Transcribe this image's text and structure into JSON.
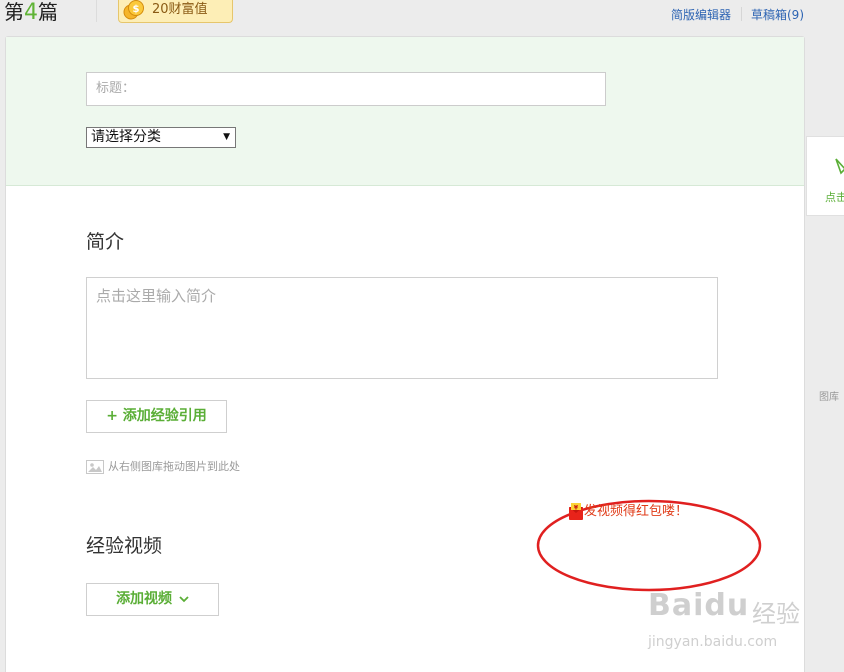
{
  "header": {
    "article_prefix": "第",
    "article_number": "4",
    "article_suffix": "篇",
    "wealth_label": "20财富值",
    "links": {
      "simple_editor": "简版编辑器",
      "drafts": "草稿箱(9)"
    }
  },
  "form": {
    "title_placeholder": "标题：",
    "category_select": "请选择分类",
    "intro_heading": "简介",
    "intro_placeholder": "点击这里输入简介",
    "add_reference_button": "+ 添加经验引用",
    "drag_hint": "从右侧图库拖动图片到此处",
    "video_heading": "经验视频",
    "add_video_button": "添加视频",
    "video_promo": "发视频得红包喽！"
  },
  "side_panel": {
    "label": "点击",
    "hint": "图库"
  },
  "watermark": {
    "brand": "Baidu",
    "brand_cn": "经验",
    "url": "jingyan.baidu.com"
  },
  "colors": {
    "accent_green": "#5aae36",
    "link_blue": "#2d64b3",
    "promo_red": "#e03a17",
    "title_panel_bg": "#eef8ee"
  },
  "icons": [
    "coin-icon",
    "chevron-down-icon",
    "image-icon",
    "red-packet-icon",
    "edit-icon"
  ]
}
